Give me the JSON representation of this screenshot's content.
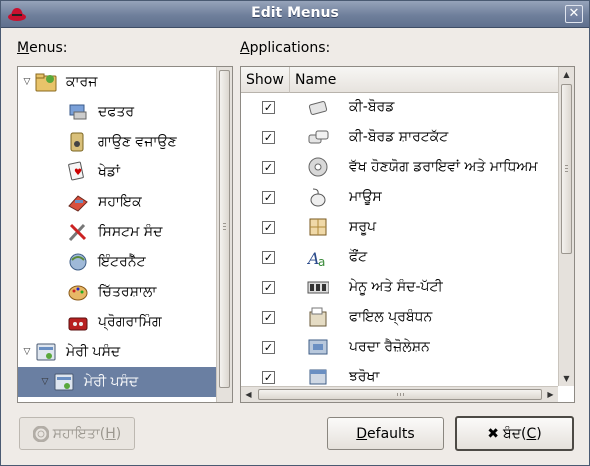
{
  "window": {
    "title": "Edit Menus"
  },
  "menus_label": {
    "mnemonic": "M",
    "rest": "enus:"
  },
  "apps_label": {
    "mnemonic": "A",
    "rest": "pplications:"
  },
  "menus_tree": [
    {
      "label": "ਕਾਰਜ",
      "icon": "folder-icon",
      "expanded": true,
      "level": 0
    },
    {
      "label": "ਦਫਤਰ",
      "icon": "office-icon",
      "level": 1
    },
    {
      "label": "ਗਾਉਣ ਵਜਾਉਣ",
      "icon": "multimedia-icon",
      "level": 1
    },
    {
      "label": "ਖੇਡਾਂ",
      "icon": "games-icon",
      "level": 1
    },
    {
      "label": "ਸਹਾਇਕ",
      "icon": "accessories-icon",
      "level": 1
    },
    {
      "label": "ਸਿਸਟਮ ਸੰਦ",
      "icon": "system-tools-icon",
      "level": 1
    },
    {
      "label": "ਇੰਟਰਨੈੱਟ",
      "icon": "internet-icon",
      "level": 1
    },
    {
      "label": "ਚਿੱਤਰਸ਼ਾਲਾ",
      "icon": "graphics-icon",
      "level": 1
    },
    {
      "label": "ਪ੍ਰੋਗਰਾਮਿੰਗ",
      "icon": "programming-icon",
      "level": 1
    },
    {
      "label": "ਮੇਰੀ ਪਸੰਦ",
      "icon": "preferences-icon",
      "expanded": true,
      "level": 0
    },
    {
      "label": "ਮੇਰੀ ਪਸੰਦ",
      "icon": "preferences-icon",
      "expanded": true,
      "level": 1,
      "selected": true
    }
  ],
  "apps_columns": {
    "show": "Show",
    "name": "Name"
  },
  "apps": [
    {
      "name": "ਕੀ-ਬੋਰਡ",
      "checked": true,
      "icon": "keyboard-icon"
    },
    {
      "name": "ਕੀ-ਬੋਰਡ ਸ਼ਾਰਟਕੱਟ",
      "checked": true,
      "icon": "keyboard-shortcuts-icon"
    },
    {
      "name": "ਵੱਖ ਹੋਣਯੋਗ ਡਰਾਇਵਾਂ ਅਤੇ ਮਾਧਿਅਮ",
      "checked": true,
      "icon": "removable-drives-icon"
    },
    {
      "name": "ਮਾਊਸ",
      "checked": true,
      "icon": "mouse-icon"
    },
    {
      "name": "ਸਰੂਪ",
      "checked": true,
      "icon": "theme-icon"
    },
    {
      "name": "ਫੌਂਟ",
      "checked": true,
      "icon": "font-icon"
    },
    {
      "name": "ਮੇਨੂ ਅਤੇ ਸੰਦ-ਪੱਟੀ",
      "checked": true,
      "icon": "menus-toolbars-icon"
    },
    {
      "name": "ਫਾਇਲ ਪ੍ਰਬੰਧਨ",
      "checked": true,
      "icon": "file-management-icon"
    },
    {
      "name": "ਪਰਦਾ ਰੈਜ਼ੋਲੇਸ਼ਨ",
      "checked": true,
      "icon": "screen-resolution-icon"
    },
    {
      "name": "ਝਰੋਖਾ",
      "checked": true,
      "icon": "windows-icon"
    }
  ],
  "buttons": {
    "help": {
      "label": "ਸਹਾਇਤਾ(",
      "mnemonic": "H",
      "end": ")"
    },
    "defaults": {
      "mnemonic": "D",
      "rest": "efaults"
    },
    "close": {
      "label": "ਬੰਦ(",
      "mnemonic": "C",
      "end": ")"
    }
  },
  "colors": {
    "titlebar": "#6f7f9b",
    "selection": "#6a7fa2"
  }
}
